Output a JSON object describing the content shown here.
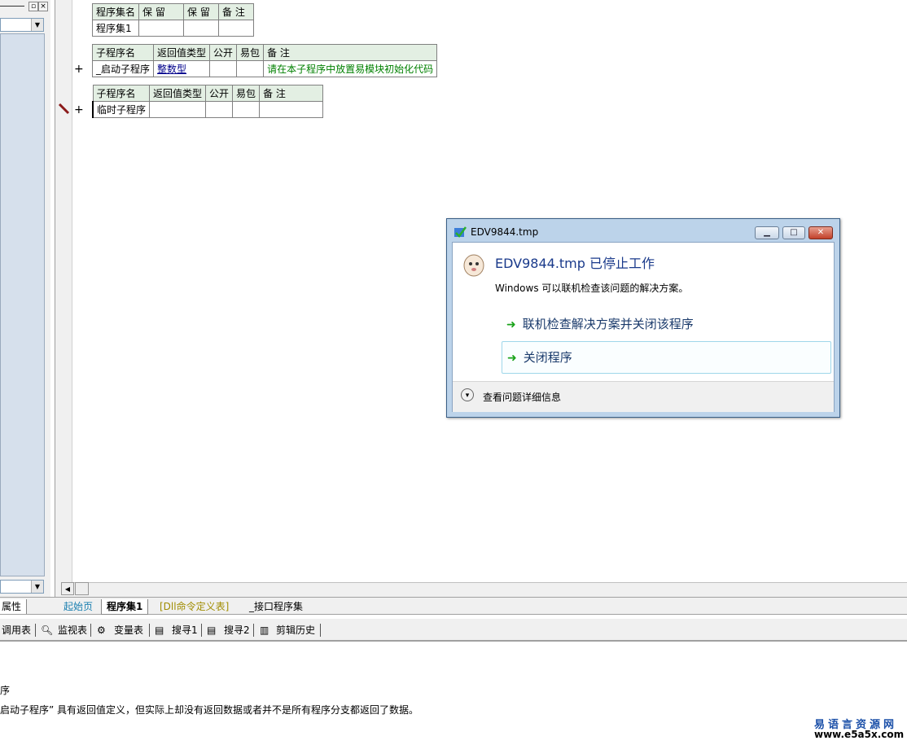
{
  "left_panel": {
    "properties_tab": "属性"
  },
  "assembly_table": {
    "headers": [
      "程序集名",
      "保 留",
      "保 留",
      "备 注"
    ],
    "row": [
      "程序集1",
      "",
      "",
      ""
    ]
  },
  "sub1_table": {
    "headers": [
      "子程序名",
      "返回值类型",
      "公开",
      "易包",
      "备 注"
    ],
    "row": [
      "_启动子程序",
      "整数型",
      "",
      "",
      "请在本子程序中放置易模块初始化代码"
    ]
  },
  "sub2_table": {
    "headers": [
      "子程序名",
      "返回值类型",
      "公开",
      "易包",
      "备 注"
    ],
    "row": [
      "临时子程序",
      "",
      "",
      "",
      ""
    ]
  },
  "gutter": {
    "plus1": "+",
    "plus2": "+"
  },
  "tabs": {
    "start": "起始页",
    "assembly": "程序集1",
    "dll": "[Dll命令定义表]",
    "interface": "_接口程序集"
  },
  "toolbar": {
    "call_table": "调用表",
    "watch": "监视表",
    "variables": "变量表",
    "search1": "搜寻1",
    "search2": "搜寻2",
    "clip_history": "剪辑历史"
  },
  "output": {
    "line1": "序",
    "line2": "启动子程序” 具有返回值定义，但实际上却没有返回数据或者并不是所有程序分支都返回了数据。"
  },
  "watermark": {
    "line1": "易语言资源网",
    "line2": "www.e5a5x.com"
  },
  "dialog": {
    "title": "EDV9844.tmp",
    "heading": "EDV9844.tmp 已停止工作",
    "subtitle": "Windows 可以联机检查该问题的解决方案。",
    "option1": "联机检查解决方案并关闭该程序",
    "option2": "关闭程序",
    "details": "查看问题详细信息"
  }
}
